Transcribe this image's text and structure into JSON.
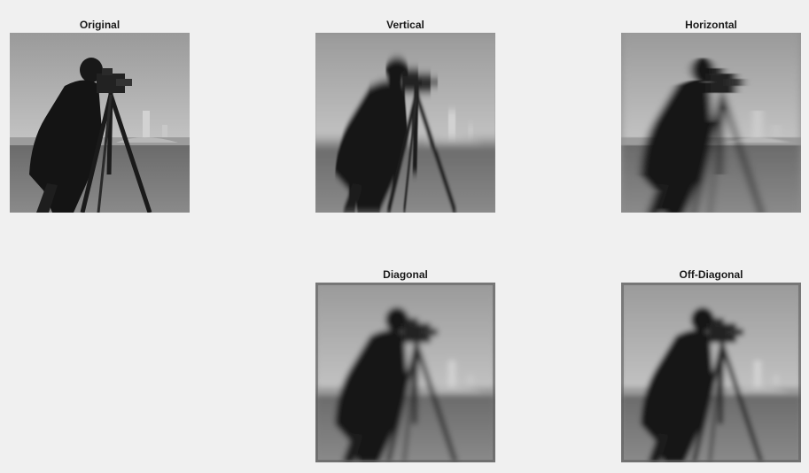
{
  "panels": [
    {
      "title": "Original"
    },
    {
      "title": "Vertical"
    },
    {
      "title": "Horizontal"
    },
    {
      "title": "Diagonal"
    },
    {
      "title": "Off-Diagonal"
    }
  ]
}
